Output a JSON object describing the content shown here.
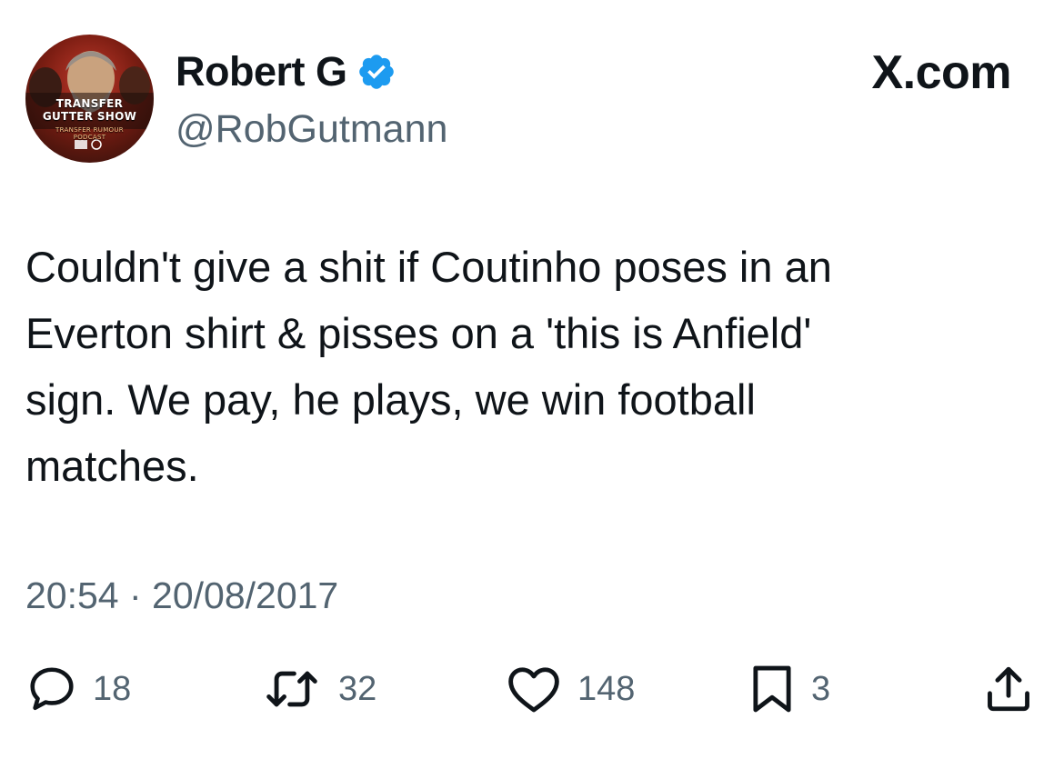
{
  "author": {
    "display_name": "Robert G",
    "handle": "@RobGutmann",
    "verified": true,
    "avatar_text": {
      "line1": "TRANSFER",
      "line2": "GUTTER SHOW",
      "line3": "TRANSFER RUMOUR",
      "line4": "PODCAST"
    }
  },
  "brand": "X.com",
  "tweet": {
    "text": "Couldn't give a shit if Coutinho poses in an\nEverton shirt & pisses on a 'this is Anfield'\nsign. We pay, he plays, we win football\nmatches.",
    "timestamp": "20:54 · 20/08/2017"
  },
  "actions": {
    "replies": "18",
    "reposts": "32",
    "likes": "148",
    "bookmarks": "3"
  },
  "icons": {
    "verified": "verified-badge-icon",
    "reply": "reply-icon",
    "repost": "repost-icon",
    "like": "heart-icon",
    "bookmark": "bookmark-icon",
    "share": "share-icon"
  },
  "colors": {
    "verified_blue": "#1d9bf0",
    "text": "#0f1419",
    "secondary": "#536471"
  }
}
